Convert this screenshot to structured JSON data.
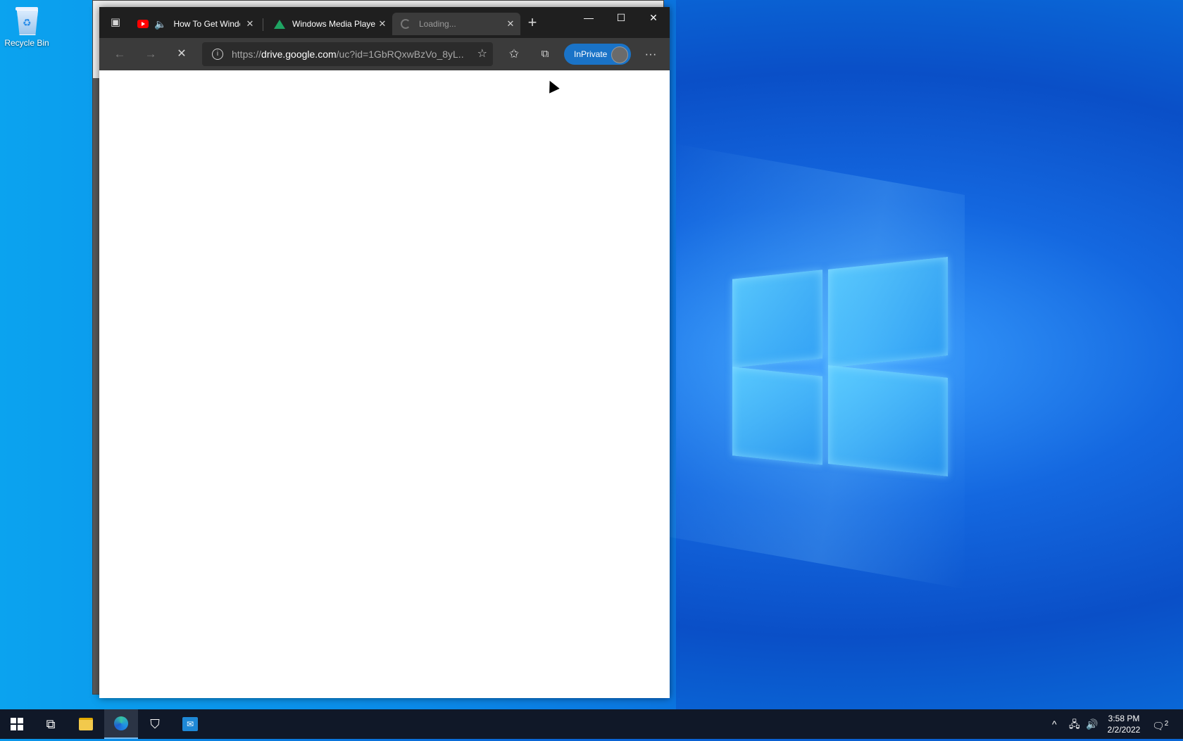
{
  "desktop": {
    "icons": [
      {
        "label": "Recycle Bin"
      }
    ]
  },
  "browser": {
    "tabs": [
      {
        "title": "How To Get Windows",
        "audio": true,
        "favicon": "youtube-icon"
      },
      {
        "title": "Windows Media Player",
        "favicon": "google-drive-icon"
      },
      {
        "title": "Loading...",
        "active": true,
        "favicon": "spinner-icon"
      }
    ],
    "new_tab_symbol": "+",
    "address": {
      "prefix": "https://",
      "host": "drive.google.com",
      "path": "/uc?id=1GbRQxwBzVo_8yL..."
    },
    "inprivate_label": "InPrivate",
    "window_controls": {
      "minimize": "—",
      "maximize": "☐",
      "close": "✕"
    }
  },
  "taskbar": {
    "time": "3:58 PM",
    "date": "2/2/2022",
    "notification_count": "2"
  },
  "colors": {
    "titlebar": "#1f1f1f",
    "toolbar": "#3b3b3b",
    "inprivate": "#1a73c7",
    "taskbar": "#101828"
  }
}
